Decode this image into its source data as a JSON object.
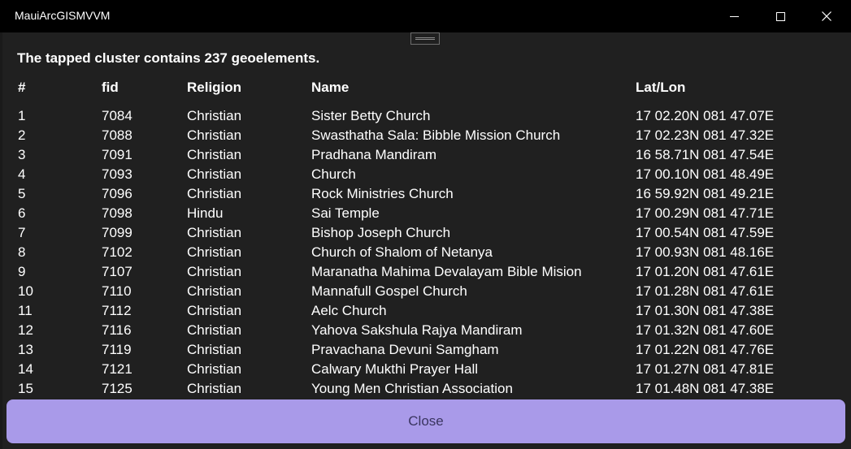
{
  "window": {
    "title": "MauiArcGISMVVM",
    "controls": {
      "minimize": "minimize-icon",
      "maximize": "maximize-icon",
      "close": "close-icon"
    }
  },
  "dialog": {
    "summary": "The tapped cluster contains 237 geoelements.",
    "columns": [
      "#",
      "fid",
      "Religion",
      "Name",
      "Lat/Lon"
    ],
    "rows": [
      {
        "idx": "1",
        "fid": "7084",
        "religion": "Christian",
        "name": "Sister Betty Church",
        "latlon": "17 02.20N 081 47.07E"
      },
      {
        "idx": "2",
        "fid": "7088",
        "religion": "Christian",
        "name": "Swasthatha Sala: Bibble Mission Church",
        "latlon": "17 02.23N 081 47.32E"
      },
      {
        "idx": "3",
        "fid": "7091",
        "religion": "Christian",
        "name": "Pradhana Mandiram",
        "latlon": "16 58.71N 081 47.54E"
      },
      {
        "idx": "4",
        "fid": "7093",
        "religion": "Christian",
        "name": "Church",
        "latlon": "17 00.10N 081 48.49E"
      },
      {
        "idx": "5",
        "fid": "7096",
        "religion": "Christian",
        "name": "Rock Ministries Church",
        "latlon": "16 59.92N 081 49.21E"
      },
      {
        "idx": "6",
        "fid": "7098",
        "religion": "Hindu",
        "name": "Sai Temple",
        "latlon": "17 00.29N 081 47.71E"
      },
      {
        "idx": "7",
        "fid": "7099",
        "religion": "Christian",
        "name": "Bishop Joseph Church",
        "latlon": "17 00.54N 081 47.59E"
      },
      {
        "idx": "8",
        "fid": "7102",
        "religion": "Christian",
        "name": "Church of Shalom of Netanya",
        "latlon": "17 00.93N 081 48.16E"
      },
      {
        "idx": "9",
        "fid": "7107",
        "religion": "Christian",
        "name": "Maranatha Mahima Devalayam Bible Mision",
        "latlon": "17 01.20N 081 47.61E"
      },
      {
        "idx": "10",
        "fid": "7110",
        "religion": "Christian",
        "name": "Mannafull Gospel Church",
        "latlon": "17 01.28N 081 47.61E"
      },
      {
        "idx": "11",
        "fid": "7112",
        "religion": "Christian",
        "name": "Aelc Church",
        "latlon": "17 01.30N 081 47.38E"
      },
      {
        "idx": "12",
        "fid": "7116",
        "religion": "Christian",
        "name": "Yahova Sakshula Rajya Mandiram",
        "latlon": "17 01.32N 081 47.60E"
      },
      {
        "idx": "13",
        "fid": "7119",
        "religion": "Christian",
        "name": "Pravachana Devuni Samgham",
        "latlon": "17 01.22N 081 47.76E"
      },
      {
        "idx": "14",
        "fid": "7121",
        "religion": "Christian",
        "name": "Calwary Mukthi Prayer Hall",
        "latlon": "17 01.27N 081 47.81E"
      },
      {
        "idx": "15",
        "fid": "7125",
        "religion": "Christian",
        "name": "Young Men Christian Association",
        "latlon": "17 01.48N 081 47.38E"
      }
    ],
    "close_label": "Close",
    "accent_color": "#a99ae9"
  }
}
